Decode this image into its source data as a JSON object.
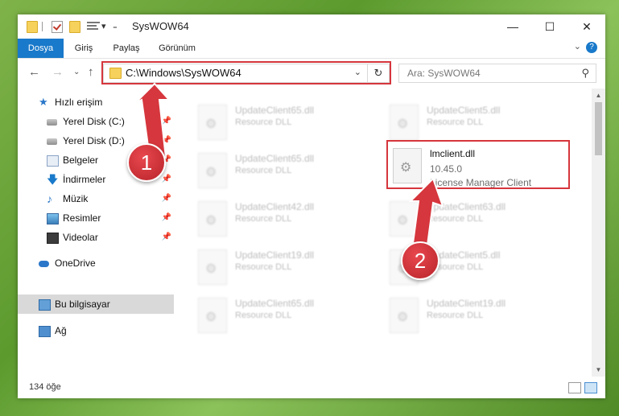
{
  "window": {
    "title": "SysWOW64"
  },
  "ribbon": {
    "tabs": [
      {
        "label": "Dosya",
        "active": true
      },
      {
        "label": "Giriş",
        "active": false
      },
      {
        "label": "Paylaş",
        "active": false
      },
      {
        "label": "Görünüm",
        "active": false
      }
    ],
    "help": "?"
  },
  "address_bar": {
    "path": "C:\\Windows\\SysWOW64",
    "refresh_icon": "refresh-icon"
  },
  "search": {
    "placeholder": "Ara: SysWOW64"
  },
  "nav_pane": {
    "quick_access": "Hızlı erişim",
    "items": [
      {
        "label": "Yerel Disk (C:)",
        "icon": "disk-icon",
        "pinned": true
      },
      {
        "label": "Yerel Disk (D:)",
        "icon": "disk-icon",
        "pinned": true
      },
      {
        "label": "Belgeler",
        "icon": "documents-icon",
        "pinned": true
      },
      {
        "label": "İndirmeler",
        "icon": "downloads-icon",
        "pinned": true
      },
      {
        "label": "Müzik",
        "icon": "music-icon",
        "pinned": true
      },
      {
        "label": "Resimler",
        "icon": "pictures-icon",
        "pinned": true
      },
      {
        "label": "Videolar",
        "icon": "videos-icon",
        "pinned": true
      }
    ],
    "onedrive": "OneDrive",
    "this_pc": "Bu bilgisayar",
    "network": "Ağ"
  },
  "files": {
    "left_column": [
      {
        "name": "UpdateClient65.dll",
        "desc": "Resource DLL"
      },
      {
        "name": "UpdateClient65.dll",
        "desc": "Resource DLL"
      },
      {
        "name": "UpdateClient42.dll",
        "desc": "Resource DLL"
      },
      {
        "name": "UpdateClient19.dll",
        "desc": "Resource DLL"
      },
      {
        "name": "UpdateClient65.dll",
        "desc": "Resource DLL"
      }
    ],
    "right_column": [
      {
        "name": "UpdateClient5.dll",
        "desc": "Resource DLL"
      },
      {
        "name": "UpdateClient63.dll",
        "desc": "Resource DLL"
      },
      {
        "name": "UpdateClient5.dll",
        "desc": "Resource DLL"
      },
      {
        "name": "UpdateClient19.dll",
        "desc": "Resource DLL"
      }
    ],
    "focused": {
      "name": "lmclient.dll",
      "version": "10.45.0",
      "company": "License Manager Client"
    }
  },
  "status": {
    "item_count": "134 öğe"
  },
  "callouts": {
    "one": "1",
    "two": "2"
  },
  "colors": {
    "accent": "#1979ca",
    "highlight": "#d6363d"
  }
}
